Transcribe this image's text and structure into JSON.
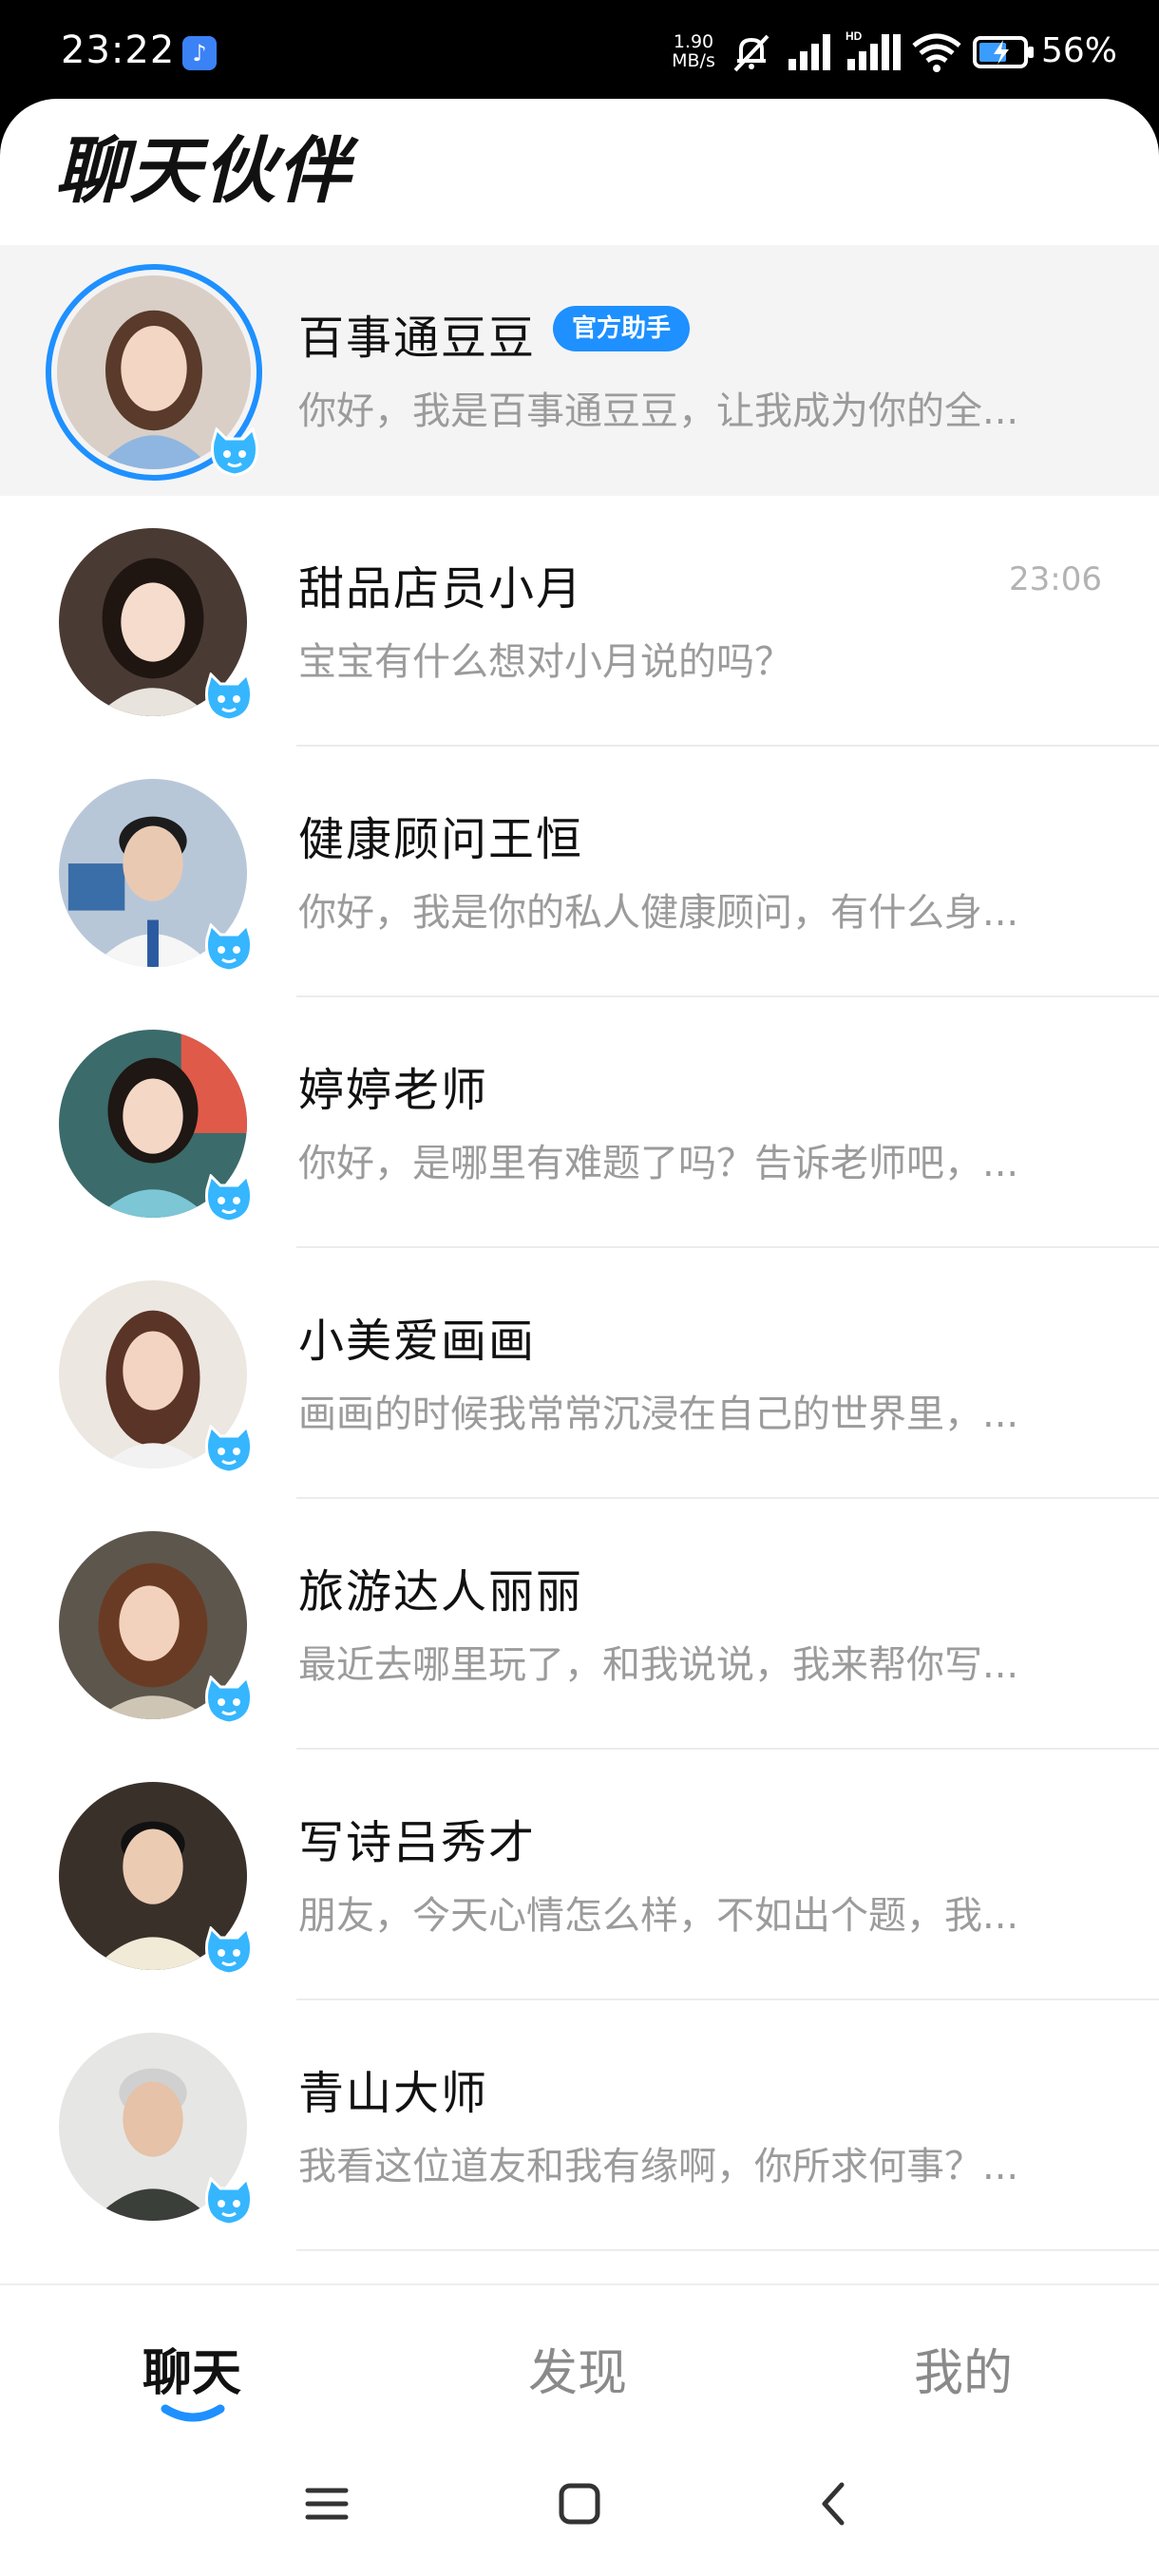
{
  "status_bar": {
    "time": "23:22",
    "app_icon": "tiktok-icon",
    "net_speed_value": "1.90",
    "net_speed_unit": "MB/s",
    "battery_percent": "56%",
    "icons": [
      "mute-icon",
      "signal-icon",
      "hd-signal-icon",
      "wifi-icon",
      "battery-charging-icon"
    ]
  },
  "header": {
    "title": "聊天伙伴"
  },
  "colors": {
    "accent": "#1e90ff",
    "preview_text": "#9b9b9b",
    "time_text": "#b3b3b3"
  },
  "chats": [
    {
      "name": "百事通豆豆",
      "tag": "官方助手",
      "time": "",
      "preview": "你好，我是百事通豆豆，让我成为你的全...",
      "active": true
    },
    {
      "name": "甜品店员小月",
      "tag": "",
      "time": "23:06",
      "preview": "宝宝有什么想对小月说的吗？"
    },
    {
      "name": "健康顾问王恒",
      "tag": "",
      "time": "",
      "preview": "你好，我是你的私人健康顾问，有什么身..."
    },
    {
      "name": "婷婷老师",
      "tag": "",
      "time": "",
      "preview": "你好，是哪里有难题了吗？告诉老师吧，..."
    },
    {
      "name": "小美爱画画",
      "tag": "",
      "time": "",
      "preview": "画画的时候我常常沉浸在自己的世界里，..."
    },
    {
      "name": "旅游达人丽丽",
      "tag": "",
      "time": "",
      "preview": "最近去哪里玩了，和我说说，我来帮你写..."
    },
    {
      "name": "写诗吕秀才",
      "tag": "",
      "time": "",
      "preview": "朋友，今天心情怎么样，不如出个题，我..."
    },
    {
      "name": "青山大师",
      "tag": "",
      "time": "",
      "preview": "我看这位道友和我有缘啊，你所求何事？..."
    }
  ],
  "bottom_nav": {
    "tabs": [
      {
        "label": "聊天",
        "active": true
      },
      {
        "label": "发现",
        "active": false
      },
      {
        "label": "我的",
        "active": false
      }
    ]
  },
  "system_nav": {
    "icons": [
      "menu-icon",
      "home-icon",
      "back-icon"
    ]
  }
}
